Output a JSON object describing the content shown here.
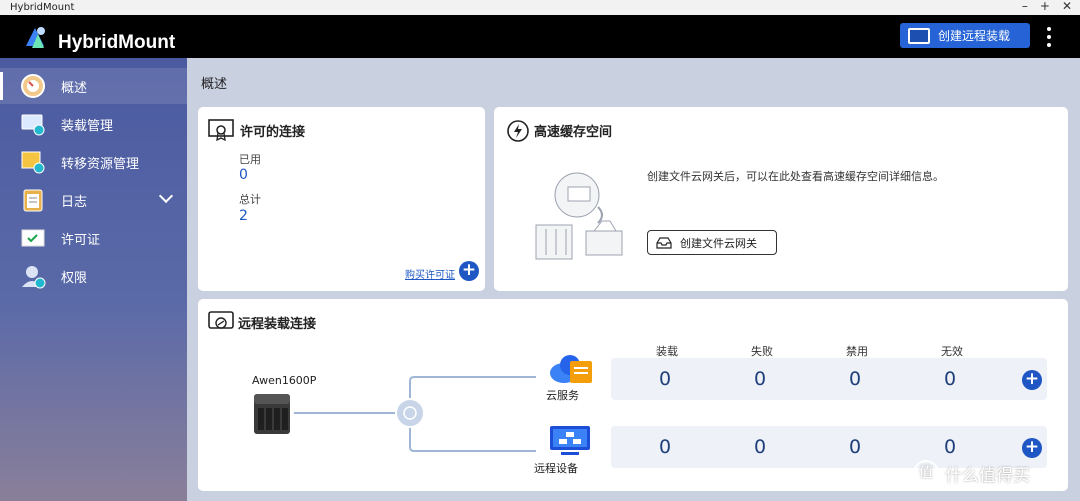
{
  "window": {
    "title": "HybridMount",
    "controls": [
      "–",
      "+",
      "✕"
    ]
  },
  "header": {
    "app_name": "HybridMount",
    "remote_button_label": "创建远程装载",
    "menu_icon": "kebab-menu-icon"
  },
  "sidebar": {
    "items": [
      {
        "label": "概述",
        "icon": "dashboard-gauge-icon",
        "active": true
      },
      {
        "label": "装载管理",
        "icon": "mount-management-icon"
      },
      {
        "label": "转移资源管理",
        "icon": "transfer-resource-icon"
      },
      {
        "label": "日志",
        "icon": "log-clipboard-icon",
        "expandable": true
      },
      {
        "label": "许可证",
        "icon": "license-certificate-icon"
      },
      {
        "label": "权限",
        "icon": "user-permission-icon"
      }
    ]
  },
  "main": {
    "title": "概述",
    "license_card": {
      "title": "许可的连接",
      "used_label": "已用",
      "used_value": "0",
      "total_label": "总计",
      "total_value": "2",
      "buy_link": "购买许可证"
    },
    "cache_card": {
      "title": "高速缓存空间",
      "description": "创建文件云网关后，可以在此处查看高速缓存空间详细信息。",
      "create_button": "创建文件云网关"
    },
    "remote_card": {
      "title": "远程装载连接",
      "device_name": "Awen1600P",
      "columns": [
        "装载",
        "失败",
        "禁用",
        "无效"
      ],
      "rows": [
        {
          "label": "云服务",
          "values": [
            "0",
            "0",
            "0",
            "0"
          ]
        },
        {
          "label": "远程设备",
          "values": [
            "0",
            "0",
            "0",
            "0"
          ]
        }
      ]
    }
  },
  "watermark": {
    "text": "什么值得买",
    "icon": "值"
  },
  "colors": {
    "accent": "#1e57c4",
    "header": "#000000",
    "sidebar_top": "#4b5aa0",
    "background": "#c9d0e0"
  }
}
